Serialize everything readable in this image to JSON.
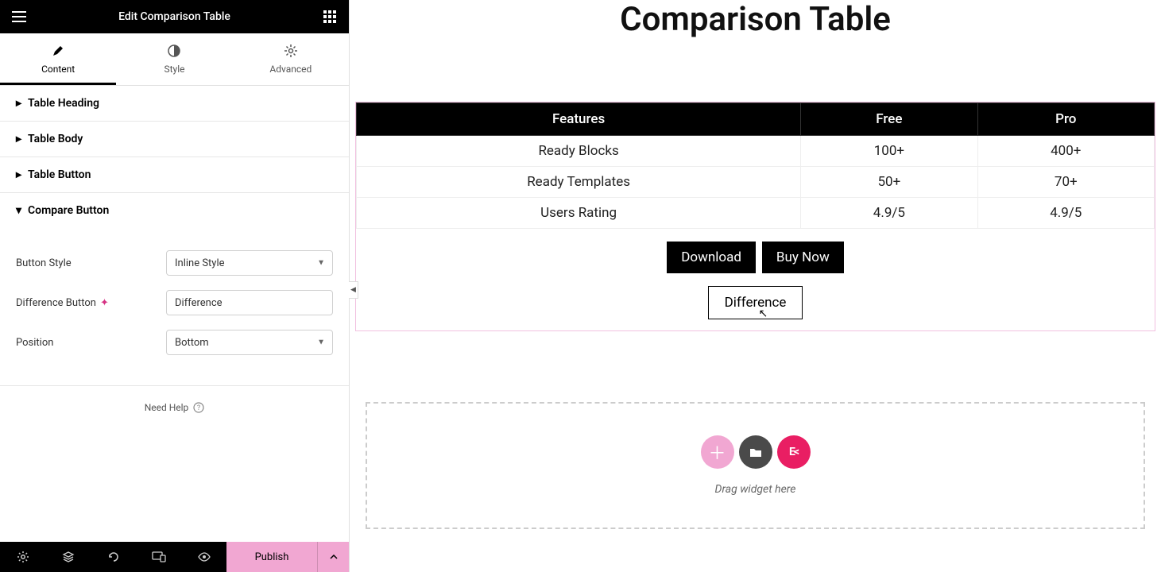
{
  "header": {
    "title": "Edit Comparison Table"
  },
  "tabs": {
    "content": "Content",
    "style": "Style",
    "advanced": "Advanced"
  },
  "sections": {
    "heading": "Table Heading",
    "body": "Table Body",
    "button": "Table Button",
    "compare": "Compare Button"
  },
  "form": {
    "button_style_label": "Button Style",
    "button_style_value": "Inline Style",
    "diff_button_label": "Difference Button",
    "diff_button_value": "Difference",
    "position_label": "Position",
    "position_value": "Bottom"
  },
  "help": "Need Help",
  "footer": {
    "publish": "Publish"
  },
  "preview": {
    "title": "Comparison Table",
    "headers": [
      "Features",
      "Free",
      "Pro"
    ],
    "rows": [
      [
        "Ready Blocks",
        "100+",
        "400+"
      ],
      [
        "Ready Templates",
        "50+",
        "70+"
      ],
      [
        "Users Rating",
        "4.9/5",
        "4.9/5"
      ]
    ],
    "download": "Download",
    "buy": "Buy Now",
    "difference": "Difference",
    "dropzone": "Drag widget here"
  }
}
